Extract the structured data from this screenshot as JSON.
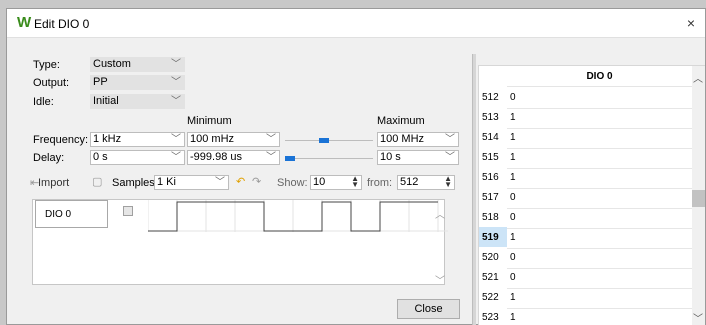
{
  "window": {
    "title": "Edit DIO 0",
    "close_glyph": "×",
    "accent": "#3a8c1c"
  },
  "form": {
    "type_label": "Type:",
    "type_value": "Custom",
    "output_label": "Output:",
    "output_value": "PP",
    "idle_label": "Idle:",
    "idle_value": "Initial",
    "minimum_header": "Minimum",
    "maximum_header": "Maximum",
    "frequency_label": "Frequency:",
    "frequency_value": "1 kHz",
    "frequency_min": "100 mHz",
    "frequency_max": "100 MHz",
    "delay_label": "Delay:",
    "delay_value": "0 s",
    "delay_min": "-999.98 us",
    "delay_max": "10 s"
  },
  "toolbar": {
    "import_label": "Import",
    "samples_label": "Samples:",
    "samples_value": "1 Ki",
    "show_label": "Show:",
    "show_value": "10",
    "from_label": "from:",
    "from_value": "512"
  },
  "wave": {
    "signal_name": "DIO 0"
  },
  "buttons": {
    "close_label": "Close"
  },
  "table": {
    "header": "DIO 0",
    "selected_index": "519",
    "rows": [
      {
        "idx": "512",
        "val": "0"
      },
      {
        "idx": "513",
        "val": "1"
      },
      {
        "idx": "514",
        "val": "1"
      },
      {
        "idx": "515",
        "val": "1"
      },
      {
        "idx": "516",
        "val": "1"
      },
      {
        "idx": "517",
        "val": "0"
      },
      {
        "idx": "518",
        "val": "0"
      },
      {
        "idx": "519",
        "val": "1"
      },
      {
        "idx": "520",
        "val": "0"
      },
      {
        "idx": "521",
        "val": "0"
      },
      {
        "idx": "522",
        "val": "1"
      },
      {
        "idx": "523",
        "val": "1"
      }
    ]
  }
}
